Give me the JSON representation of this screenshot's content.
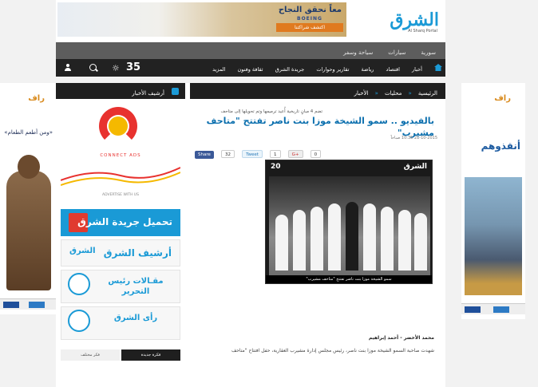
{
  "header": {
    "banner": {
      "headline": "معاً نحقق النجاح",
      "cta": "اكتشف شراكتنا",
      "brand": "BOEING"
    },
    "logo": {
      "name": "الشرق",
      "tagline": "Al Sharq Portal"
    }
  },
  "subnav": {
    "items": [
      "سورية",
      "سيارات",
      "سياحة وسفر"
    ]
  },
  "mainnav": {
    "items": [
      "أخبار",
      "اقتصاد",
      "رياضة",
      "تقارير وحوارات",
      "جريدة الشرق",
      "ثقافة وفنون",
      "المزيد"
    ],
    "temperature": "35"
  },
  "breadcrumb": {
    "items": [
      "الرئيسية",
      "محليات",
      "الأخبار"
    ]
  },
  "archive_bar": {
    "label": "أرشيف الأخبار"
  },
  "article": {
    "kicker": "تضم 4 مبانٍ تاريخية أُعيد ترميمها وتم تحويلها إلى متاحف",
    "headline": "بالفيديو .. سمو الشيخة موزا بنت ناصر تفتتح \"متاحف مشيرب\"",
    "date": "21-10-2015 10:35 صباحاً",
    "share": {
      "facebook": "Share",
      "fb_count": "32",
      "tweet": "Tweet",
      "tw_count": "1",
      "gplus": "G+",
      "gp_count": "0"
    },
    "photo_caption": "سمو الشيخة موزا بنت ناصر تفتتح \"متاحف مشيرب\"",
    "photo_logo": "الشرق",
    "photo_badge": "20",
    "byline": "محمد الأخضر - أحمد إبراهيم",
    "body": "شهدت صاحبة السمو الشيخة موزا بنت ناصر، رئيس مجلس إدارة مشيرب العقارية، حفل افتتاح \"متاحف"
  },
  "left_column": {
    "ad": {
      "title": "CONNECT ADS",
      "sub": "ADVERTISE WITH US"
    },
    "tiles": {
      "download": "تحميل جريدة الشرق",
      "archive": "أرشيف الشرق",
      "archive_logo": "الشرق",
      "editor": "مقـالات رئيس التحرير",
      "opinion": "رأى الشرق"
    },
    "bottom_tabs": {
      "dark": "فكرة جديدة",
      "light": "فكر مختلف"
    }
  },
  "side_left": {
    "logo": "راف",
    "slogan": "«ومن أطعم الطعام»"
  },
  "side_right": {
    "logo": "راف",
    "slogan": "أنقذوهم"
  }
}
